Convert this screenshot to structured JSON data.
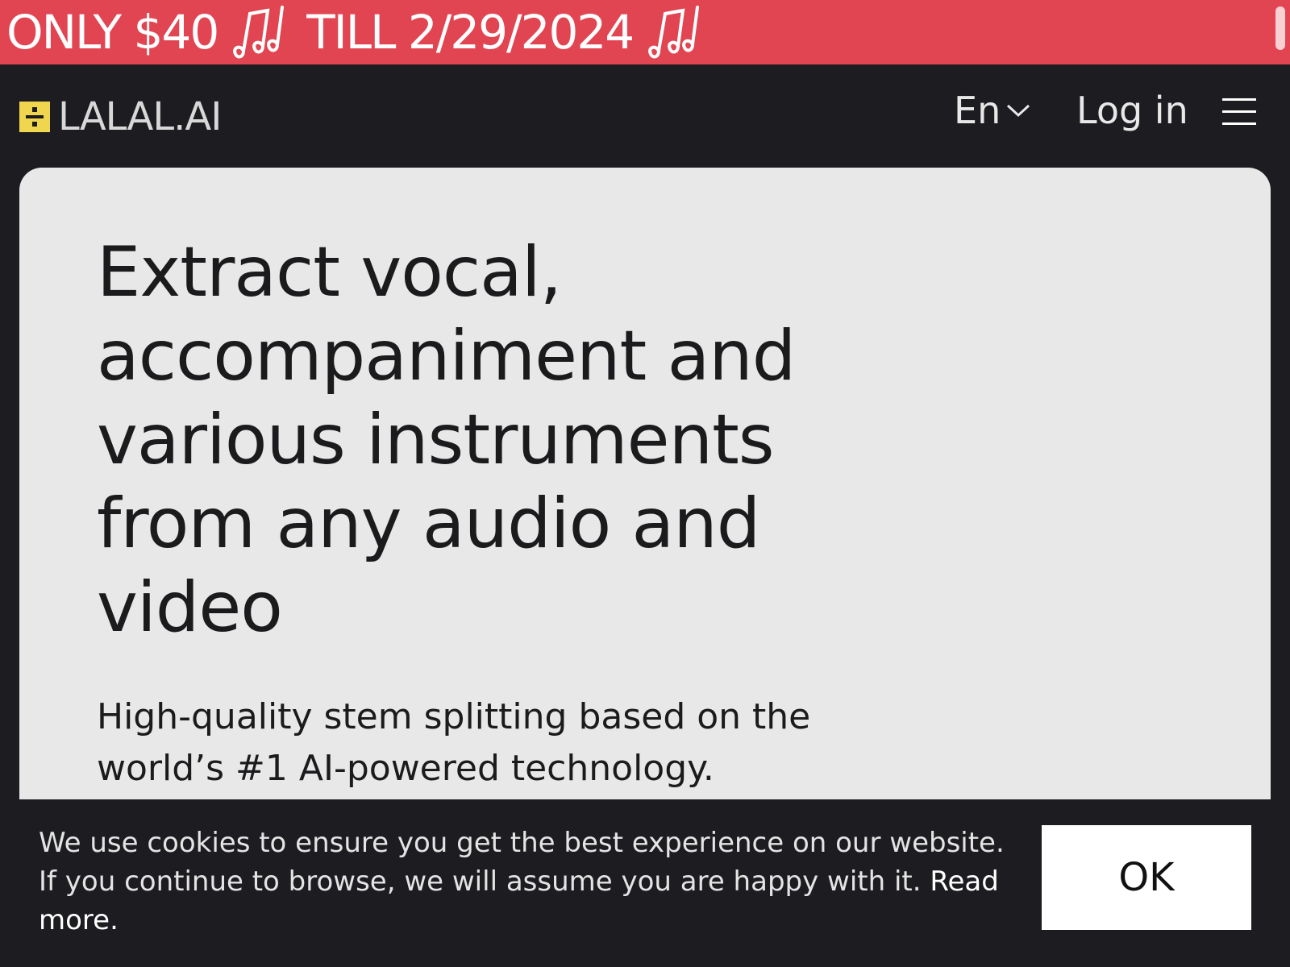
{
  "promo": {
    "part1": "ONLY $40",
    "part2": "TILL 2/29/2024",
    "icon": "music-notes-icon",
    "background": "#e24552"
  },
  "header": {
    "logo_text": "LALAL.AI",
    "logo_color": "#f0d64e",
    "language": "En",
    "login": "Log in"
  },
  "hero": {
    "headline": "Extract vocal, accompaniment and various instruments from any audio and video",
    "subheadline": "High-quality stem splitting based on the world’s #1 AI-powered technology."
  },
  "cookie": {
    "text": "We use cookies to ensure you get the best experience on our website. If you continue to browse, we will assume you are happy with it.",
    "link": "Read more.",
    "button": "OK"
  }
}
